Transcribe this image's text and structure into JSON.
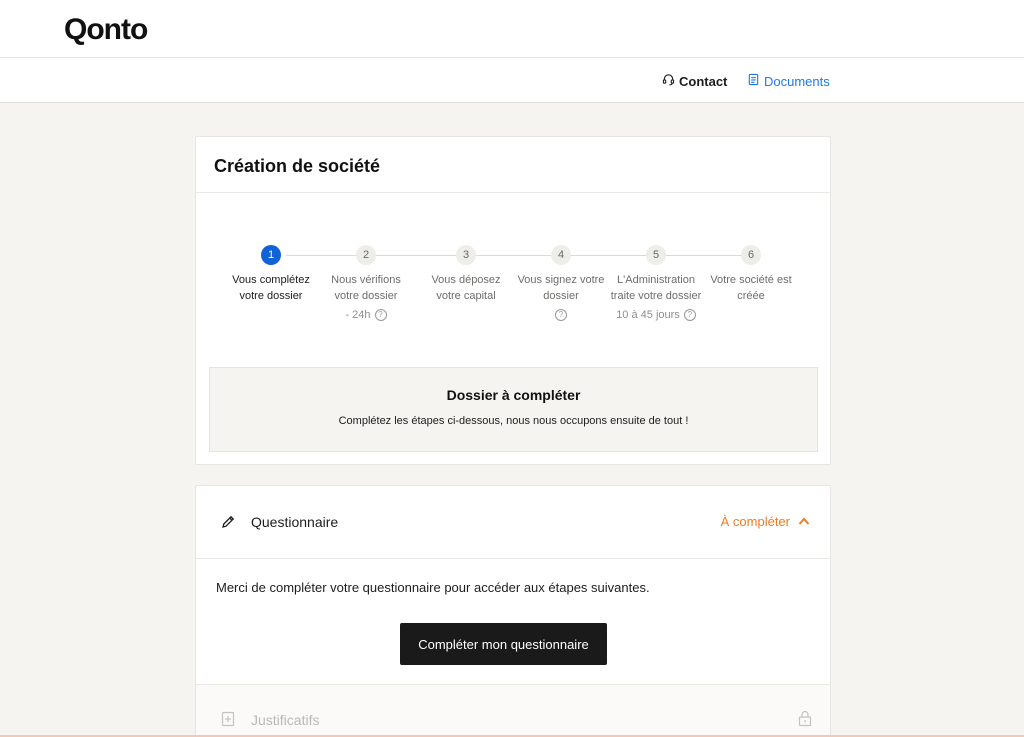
{
  "brand": {
    "logo": "Qonto"
  },
  "nav": {
    "contact": "Contact",
    "documents": "Documents",
    "documents_color": "#1f7ae0"
  },
  "creation": {
    "title": "Création de société",
    "steps": [
      {
        "num": "1",
        "label": "Vous complétez votre dossier",
        "sub": "",
        "help": false,
        "active": true
      },
      {
        "num": "2",
        "label": "Nous vérifions votre dossier",
        "sub": "- 24h",
        "help": true,
        "active": false
      },
      {
        "num": "3",
        "label": "Vous déposez votre capital",
        "sub": "",
        "help": false,
        "active": false
      },
      {
        "num": "4",
        "label": "Vous signez votre dossier",
        "sub": "",
        "help": true,
        "active": false
      },
      {
        "num": "5",
        "label": "L'Administration traite votre dossier",
        "sub": "10 à 45 jours",
        "help": true,
        "active": false
      },
      {
        "num": "6",
        "label": "Votre société est créée",
        "sub": "",
        "help": false,
        "active": false
      }
    ],
    "notice": {
      "title": "Dossier à compléter",
      "text": "Complétez les étapes ci-dessous, nous nous occupons ensuite de tout !"
    }
  },
  "questionnaire": {
    "title": "Questionnaire",
    "status": "À compléter",
    "status_color": "#f07c21",
    "text": "Merci de compléter votre questionnaire pour accéder aux étapes suivantes.",
    "button": "Compléter mon questionnaire"
  },
  "justificatifs": {
    "title": "Justificatifs"
  },
  "icons": {
    "contact": "headset-icon",
    "documents": "document-icon",
    "questionnaire": "pencil-icon",
    "collapse": "chevron-up-icon",
    "justificatifs": "upload-file-icon",
    "locked": "lock-icon",
    "help": "question-icon"
  }
}
